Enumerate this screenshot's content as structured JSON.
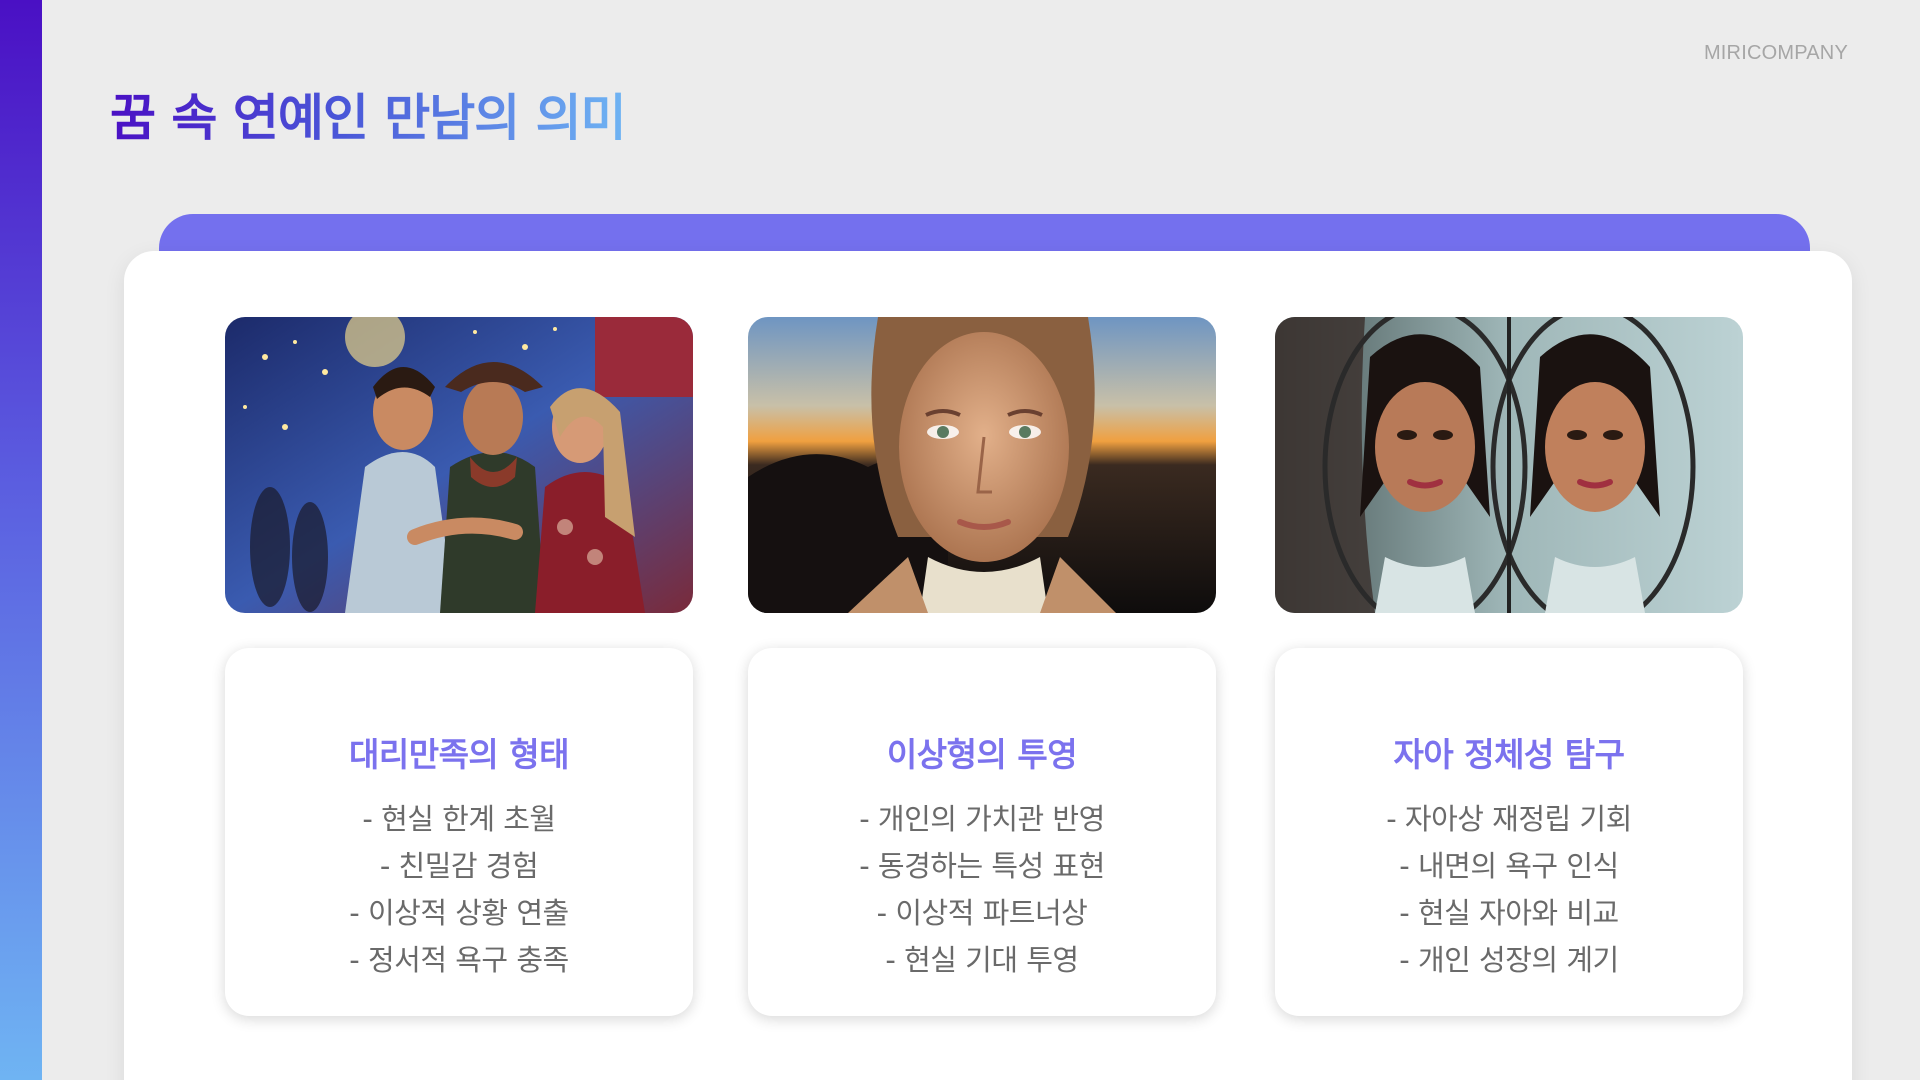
{
  "brand": "MIRICOMPANY",
  "title": "꿈 속 연예인 만남의 의미",
  "colors": {
    "accent": "#7470ee",
    "title_gradient": [
      "#4a10c4",
      "#6fb4f3"
    ],
    "sidebar_gradient": [
      "#4a10c4",
      "#6fb4f3"
    ]
  },
  "cards": [
    {
      "image": "party-celebrities-photo",
      "title": "대리만족의 형태",
      "items": [
        "- 현실 한계 초월",
        "- 친밀감 경험",
        "- 이상적 상황 연출",
        "- 정서적 욕구 충족"
      ]
    },
    {
      "image": "woman-portrait-sunset-photo",
      "title": "이상형의 투영",
      "items": [
        "- 개인의 가치관 반영",
        "- 동경하는 특성 표현",
        "- 이상적 파트너상",
        "- 현실 기대 투영"
      ]
    },
    {
      "image": "woman-mirror-reflection-photo",
      "title": "자아 정체성 탐구",
      "items": [
        "- 자아상 재정립 기회",
        "- 내면의 욕구 인식",
        "- 현실 자아와 비교",
        "- 개인 성장의 계기"
      ]
    }
  ]
}
